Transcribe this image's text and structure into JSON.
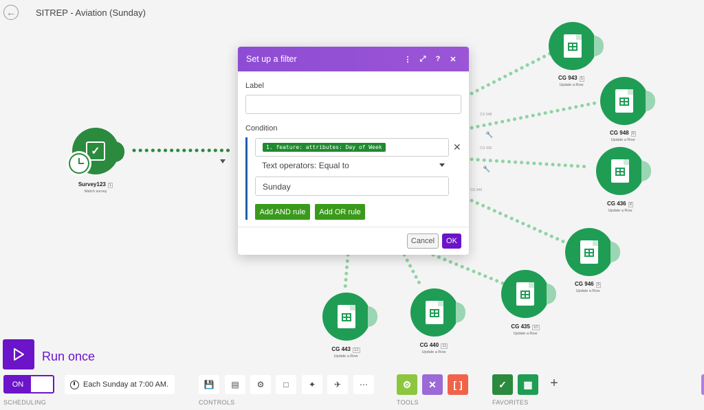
{
  "header": {
    "title": "SITREP - Aviation (Sunday)"
  },
  "trigger": {
    "name": "Survey123",
    "index": "1",
    "action": "Watch survey"
  },
  "sheet_nodes": [
    {
      "name": "CG 943",
      "index": "5",
      "action": "Update a Row"
    },
    {
      "name": "CG 948",
      "index": "6",
      "action": "Update a Row"
    },
    {
      "name": "CG 436",
      "index": "8",
      "action": "Update a Row"
    },
    {
      "name": "CG 946",
      "index": "9",
      "action": "Update a Row"
    },
    {
      "name": "CG 435",
      "index": "10",
      "action": "Update a Row"
    },
    {
      "name": "CG 440",
      "index": "11",
      "action": "Update a Row"
    },
    {
      "name": "CG 443",
      "index": "12",
      "action": "Update a Row"
    }
  ],
  "route_labels": {
    "a": "CG 948",
    "b": "CG 436",
    "c": "CG 946"
  },
  "dialog": {
    "title": "Set up a filter",
    "label_caption": "Label",
    "label_value": "",
    "condition_caption": "Condition",
    "condition_field": "1. feature: attributes: Day of Week",
    "operator": "Text operators: Equal to",
    "value": "Sunday",
    "add_and": "Add AND rule",
    "add_or": "Add OR rule",
    "cancel": "Cancel",
    "ok": "OK"
  },
  "run": {
    "label": "Run once"
  },
  "scheduling": {
    "toggle": "ON",
    "schedule": "Each Sunday at 7:00 AM.",
    "section": "SCHEDULING"
  },
  "sections": {
    "controls": "CONTROLS",
    "tools": "TOOLS",
    "favorites": "FAVORITES"
  },
  "colors": {
    "accent": "#6b14c9",
    "node": "#1f9d55",
    "dialog_header": "#8e4cd4",
    "rule_button": "#3a9a1c"
  }
}
